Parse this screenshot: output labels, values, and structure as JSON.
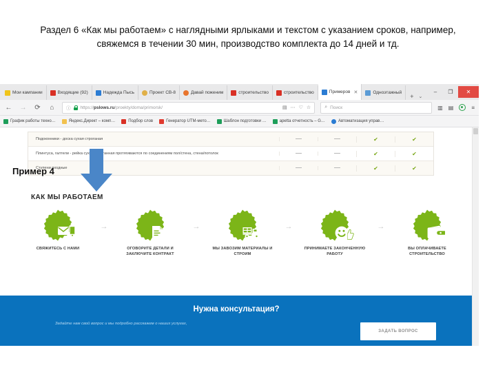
{
  "slide": {
    "title": "Раздел 6 «Как мы работаем» с наглядными ярлыками и текстом с указанием сроков, например, свяжемся в течении 30 мин, производство комплекта до 14 дней и тд.",
    "annotation_label": "Пример 4",
    "annotation_arrow_color": "#4a86c8"
  },
  "browser": {
    "tabs": [
      {
        "label": "Мои кампании",
        "favicon_color": "#f0c419",
        "active": false
      },
      {
        "label": "Входящие (92)",
        "favicon_color": "#d93025",
        "active": false
      },
      {
        "label": "Надежда Пысь",
        "favicon_color": "#2b7cd3",
        "active": false
      },
      {
        "label": "Проект СВ-8",
        "favicon_color": "#e0b048",
        "active": false
      },
      {
        "label": "Давай поженим",
        "favicon_color": "#e8742c",
        "active": false
      },
      {
        "label": "строительство",
        "favicon_color": "#d93025",
        "active": false
      },
      {
        "label": "строительство",
        "favicon_color": "#d93025",
        "active": false
      },
      {
        "label": "Примеров",
        "favicon_color": "#2b7cd3",
        "active": true
      },
      {
        "label": "Одноэтажный",
        "favicon_color": "#5b9bd5",
        "active": false
      }
    ],
    "tab_close_glyph": "✕",
    "new_tab_glyph": "+",
    "tab_list_glyph": "⌄",
    "window_controls": {
      "minimize": "–",
      "maximize": "❐",
      "close": "✕"
    },
    "nav": {
      "back": "←",
      "forward": "→",
      "reload": "⟳",
      "home": "⌂"
    },
    "address": {
      "info_glyph": "ⓘ",
      "lock": "secure-lock-icon",
      "url_prefix": "https://",
      "url_host": "pslows.ru",
      "url_path": "/proekty/doma/primorsk/",
      "reader_glyph": "▤",
      "more_glyph": "⋯",
      "pocket_glyph": "♡",
      "star_glyph": "☆"
    },
    "search": {
      "placeholder": "Поиск",
      "icon": "search-icon"
    },
    "toolbar_icons": [
      "library-icon",
      "sidebar-icon",
      "account-icon",
      "menu-icon"
    ],
    "bookmarks": [
      {
        "label": "График работы техно…",
        "color": "#1e9e5a"
      },
      {
        "label": "Яндекс.Директ – комп…",
        "color": "#f2c14e"
      },
      {
        "label": "Подбор слов",
        "color": "#d93025"
      },
      {
        "label": "Генератор UTM-мето…",
        "color": "#e03a2f"
      },
      {
        "label": "Шаблон подготовки …",
        "color": "#1e9e5a"
      },
      {
        "label": "apetta отчетность – G…",
        "color": "#1e9e5a"
      },
      {
        "label": "Автоматизация управ…",
        "color": "#2b7cd3"
      }
    ]
  },
  "page": {
    "table": {
      "rows": [
        {
          "name": "Подоконники - доска сухая строганая",
          "cells": [
            "dash",
            "dash",
            "check",
            "check"
          ]
        },
        {
          "name": "Плинтуса, галтели - рейка сухая строганная протягиваются по соединениям пол/стена, стена/потолок",
          "cells": [
            "dash",
            "dash",
            "check",
            "check"
          ]
        },
        {
          "name": "Ступени входные",
          "cells": [
            "dash",
            "dash",
            "check",
            "check"
          ]
        }
      ],
      "check_color": "#7aa818",
      "check_glyph": "✔"
    },
    "how_we_work": {
      "heading": "КАК МЫ РАБОТАЕМ",
      "accent_color": "#7cb518",
      "arrow_glyph": "→",
      "steps": [
        {
          "label": "СВЯЖИТЕСЬ С НАМИ",
          "icon": "mail-phone-icon"
        },
        {
          "label": "ОГОВОРИТЕ ДЕТАЛИ И ЗАКЛЮЧИТЕ КОНТРАКТ",
          "icon": "contract-check-icon"
        },
        {
          "label": "МЫ ЗАВОЗИМ МАТЕРИАЛЫ И СТРОИМ",
          "icon": "delivery-truck-icon"
        },
        {
          "label": "ПРИНИМАЕТЕ ЗАКОНЧЕННУЮ РАБОТУ",
          "icon": "smiley-thumbsup-icon"
        },
        {
          "label": "ВЫ ОПЛАЧИВАЕТЕ СТРОИТЕЛЬСТВО",
          "icon": "wallet-icon"
        }
      ]
    },
    "consultation": {
      "title": "Нужна консультация?",
      "subtitle": "Задайте нам свой вопрос и мы подробно расскажем о наших услугах,",
      "button_label": "ЗАДАТЬ ВОПРОС",
      "background_color": "#0a72bd"
    }
  }
}
